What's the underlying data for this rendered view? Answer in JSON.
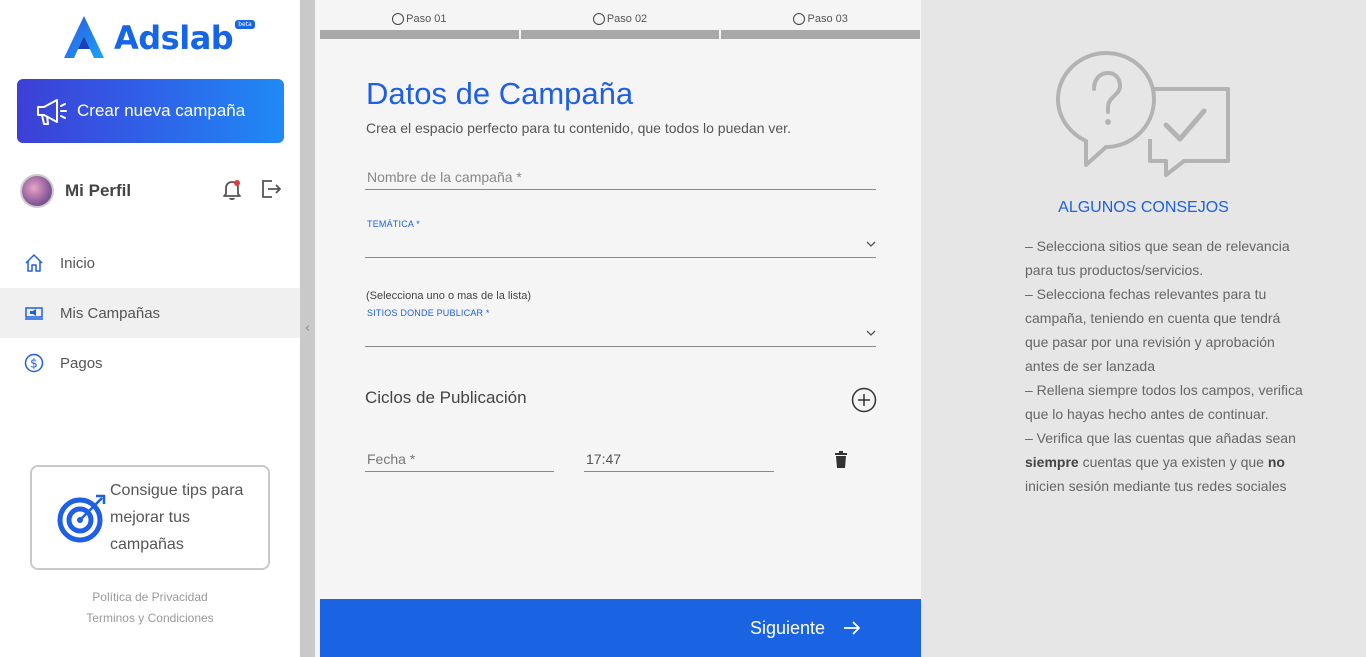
{
  "brand": {
    "name": "Adslab",
    "badge": "beta",
    "accent": "#1565e6"
  },
  "sidebar": {
    "new_campaign_label": "Crear nueva campaña",
    "profile_name": "Mi Perfil",
    "items": [
      {
        "label": "Inicio",
        "icon": "home-icon"
      },
      {
        "label": "Mis Campañas",
        "icon": "campaign-icon",
        "active": true
      },
      {
        "label": "Pagos",
        "icon": "dollar-icon"
      }
    ],
    "tips_card_label": "Consigue tips para mejorar tus campañas",
    "footer": {
      "privacy": "Política de Privacidad",
      "terms": "Terminos y Condiciones"
    }
  },
  "steps": [
    "Paso 01",
    "Paso 02",
    "Paso 03"
  ],
  "form": {
    "title": "Datos de Campaña",
    "subtitle": "Crea el espacio perfecto para tu contenido, que todos lo puedan ver.",
    "name_placeholder": "Nombre de la campaña *",
    "theme_label": "TEMÁTICA *",
    "sites_hint": "(Selecciona uno o mas de la lista)",
    "sites_label": "SITIOS DONDE PUBLICAR *",
    "cycles_title": "Ciclos de Publicación",
    "date_placeholder": "Fecha *",
    "time_value": "17:47",
    "next_label": "Siguiente"
  },
  "tips_panel": {
    "heading": "ALGUNOS CONSEJOS",
    "tip1": "–   Selecciona sitios que sean de relevancia para tus productos/servicios.",
    "tip2": "–   Selecciona fechas relevantes para tu campaña, teniendo en cuenta que tendrá que pasar por una revisión y aprobación antes de ser lanzada",
    "tip3": "–   Rellena siempre todos los campos, verifica que lo hayas hecho antes de continuar.",
    "tip4_a": "–   Verifica que las cuentas que añadas sean ",
    "tip4_b": "siempre",
    "tip4_c": " cuentas que ya existen y que ",
    "tip4_d": "no",
    "tip4_e": " inicien sesión mediante tus redes sociales"
  }
}
